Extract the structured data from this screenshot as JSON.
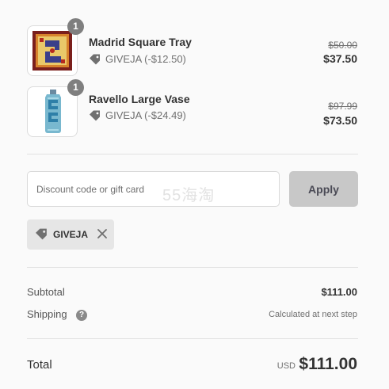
{
  "line_items": [
    {
      "name": "Madrid Square Tray",
      "quantity": "1",
      "discount_code": "GIVEJA",
      "discount_text": "GIVEJA (-$12.50)",
      "compare_price": "$50.00",
      "price": "$37.50",
      "thumb_icon": "tray-product-image"
    },
    {
      "name": "Ravello Large Vase",
      "quantity": "1",
      "discount_code": "GIVEJA",
      "discount_text": "GIVEJA (-$24.49)",
      "compare_price": "$97.99",
      "price": "$73.50",
      "thumb_icon": "vase-product-image"
    }
  ],
  "discount_form": {
    "placeholder": "Discount code or gift card",
    "value": "",
    "apply_label": "Apply"
  },
  "watermark_text": "55海淘",
  "applied_code": {
    "label": "GIVEJA",
    "tag_icon": "tag-icon",
    "remove_icon": "close-icon"
  },
  "summary": {
    "subtotal_label": "Subtotal",
    "subtotal_value": "$111.00",
    "shipping_label": "Shipping",
    "shipping_help_icon": "question-icon",
    "shipping_value": "Calculated at next step",
    "total_label": "Total",
    "currency": "USD",
    "total_value": "$111.00"
  },
  "colors": {
    "background": "#fafafa",
    "apply_button": "#c8c8c8",
    "chip_background": "#e6e6e6",
    "badge": "#7f7f7f",
    "text": "#333333",
    "muted_text": "#707070"
  }
}
